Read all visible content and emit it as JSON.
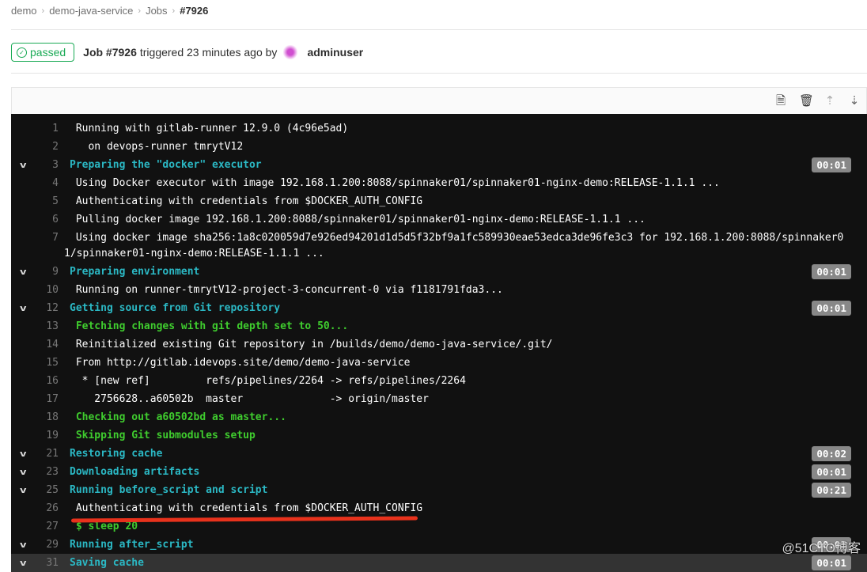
{
  "breadcrumb": [
    "demo",
    "demo-java-service",
    "Jobs",
    "#7926"
  ],
  "job": {
    "status": "passed",
    "id": "Job #7926",
    "triggered": "triggered 23 minutes ago by",
    "user": "adminuser"
  },
  "toolbar": {
    "icons": [
      "raw-log-icon",
      "erase-icon",
      "scroll-top-icon",
      "scroll-bottom-icon"
    ]
  },
  "log": [
    {
      "n": "1",
      "text": " Running with gitlab-runner 12.9.0 (4c96e5ad)",
      "type": "normal"
    },
    {
      "n": "2",
      "text": "   on devops-runner tmrytV12",
      "type": "normal"
    },
    {
      "n": "3",
      "text": "Preparing the \"docker\" executor",
      "type": "section",
      "dur": "00:01"
    },
    {
      "n": "4",
      "text": " Using Docker executor with image 192.168.1.200:8088/spinnaker01/spinnaker01-nginx-demo:RELEASE-1.1.1 ...",
      "type": "normal"
    },
    {
      "n": "5",
      "text": " Authenticating with credentials from $DOCKER_AUTH_CONFIG",
      "type": "normal"
    },
    {
      "n": "6",
      "text": " Pulling docker image 192.168.1.200:8088/spinnaker01/spinnaker01-nginx-demo:RELEASE-1.1.1 ...",
      "type": "normal"
    },
    {
      "n": "7",
      "text": " Using docker image sha256:1a8c020059d7e926ed94201d1d5d5f32bf9a1fc589930eae53edca3de96fe3c3 for 192.168.1.200:8088/spinnaker0",
      "wrap": "1/spinnaker01-nginx-demo:RELEASE-1.1.1 ...",
      "type": "normal"
    },
    {
      "n": "9",
      "text": "Preparing environment",
      "type": "section",
      "dur": "00:01"
    },
    {
      "n": "10",
      "text": " Running on runner-tmrytV12-project-3-concurrent-0 via f1181791fda3...",
      "type": "normal"
    },
    {
      "n": "12",
      "text": "Getting source from Git repository",
      "type": "section",
      "dur": "00:01"
    },
    {
      "n": "13",
      "text": " Fetching changes with git depth set to 50...",
      "type": "green"
    },
    {
      "n": "14",
      "text": " Reinitialized existing Git repository in /builds/demo/demo-java-service/.git/",
      "type": "normal"
    },
    {
      "n": "15",
      "text": " From http://gitlab.idevops.site/demo/demo-java-service",
      "type": "normal"
    },
    {
      "n": "16",
      "text": "  * [new ref]         refs/pipelines/2264 -> refs/pipelines/2264",
      "type": "normal"
    },
    {
      "n": "17",
      "text": "    2756628..a60502b  master              -> origin/master",
      "type": "normal"
    },
    {
      "n": "18",
      "text": " Checking out a60502bd as master...",
      "type": "green"
    },
    {
      "n": "19",
      "text": " Skipping Git submodules setup",
      "type": "green"
    },
    {
      "n": "21",
      "text": "Restoring cache",
      "type": "section",
      "dur": "00:02"
    },
    {
      "n": "23",
      "text": "Downloading artifacts",
      "type": "section",
      "dur": "00:01"
    },
    {
      "n": "25",
      "text": "Running before_script and script",
      "type": "section",
      "dur": "00:21"
    },
    {
      "n": "26",
      "text": " Authenticating with credentials from $DOCKER_AUTH_CONFIG",
      "type": "normal"
    },
    {
      "n": "27",
      "text": " $ sleep 20",
      "type": "green"
    },
    {
      "n": "29",
      "text": "Running after_script",
      "type": "section",
      "dur": "00:03"
    },
    {
      "n": "31",
      "text": "Saving cache",
      "type": "section",
      "dur": "00:01",
      "hl": true
    }
  ],
  "watermark": "@51CTO博客"
}
